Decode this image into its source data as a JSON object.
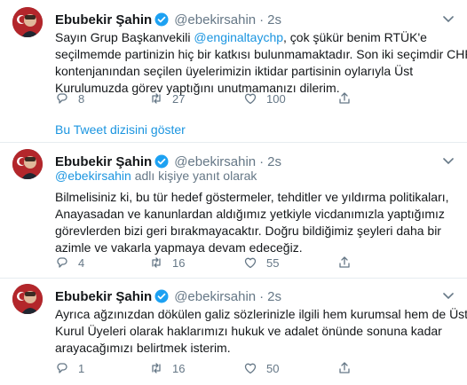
{
  "tweets": [
    {
      "author": "Ebubekir Şahin",
      "handle": "@ebekirsahin",
      "time": "2s",
      "body_lines": [
        {
          "pre": "Sayın Grup Başkanvekili ",
          "mention": "@enginaltaychp",
          "post": ", çok şükür benim RTÜK'e"
        },
        {
          "pre": "seçilmemde partinizin hiç bir katkısı bulunmamaktadır. Son iki seçimdir CHP",
          "mention": "",
          "post": ""
        },
        {
          "pre": "kontenjanından seçilen üyelerimizin iktidar partisinin oylarıyla Üst",
          "mention": "",
          "post": ""
        },
        {
          "pre": "Kurulumuzda görev yaptığını unutmamanızı dilerim.",
          "mention": "",
          "post": ""
        }
      ],
      "replies": "8",
      "retweets": "27",
      "likes": "100"
    },
    {
      "author": "Ebubekir Şahin",
      "handle": "@ebekirsahin",
      "time": "2s",
      "reply_to_mention": "@ebekirsahin",
      "reply_to_text": " adlı kişiye yanıt olarak",
      "body_lines": [
        {
          "pre": "Bilmelisiniz ki, bu tür hedef göstermeler, tehditler ve yıldırma politikaları,",
          "mention": "",
          "post": ""
        },
        {
          "pre": "Anayasadan ve kanunlardan aldığımız yetkiyle vicdanımızla yaptığımız",
          "mention": "",
          "post": ""
        },
        {
          "pre": "görevlerden bizi geri bırakmayacaktır. Doğru bildiğimiz şeyleri daha bir",
          "mention": "",
          "post": ""
        },
        {
          "pre": "azimle ve vakarla yapmaya devam edeceğiz.",
          "mention": "",
          "post": ""
        }
      ],
      "replies": "4",
      "retweets": "16",
      "likes": "55"
    },
    {
      "author": "Ebubekir Şahin",
      "handle": "@ebekirsahin",
      "time": "2s",
      "body_lines": [
        {
          "pre": "Ayrıca ağzınızdan dökülen galiz sözlerinizle ilgili hem kurumsal hem de Üst",
          "mention": "",
          "post": ""
        },
        {
          "pre": "Kurul Üyeleri olarak haklarımızı hukuk ve adalet önünde sonuna kadar",
          "mention": "",
          "post": ""
        },
        {
          "pre": "arayacağımızı belirtmek isterim.",
          "mention": "",
          "post": ""
        }
      ],
      "replies": "1",
      "retweets": "16",
      "likes": "50"
    }
  ],
  "thread_link": "Bu Tweet dizisini göster",
  "colors": {
    "accent": "#1b95e0",
    "muted": "#657786",
    "text": "#14171a",
    "divider": "#e6ecf0"
  },
  "icons": {
    "verified": "verified-badge-icon",
    "reply": "reply-icon",
    "retweet": "retweet-icon",
    "like": "heart-icon",
    "share": "share-icon",
    "more": "chevron-down-icon"
  }
}
